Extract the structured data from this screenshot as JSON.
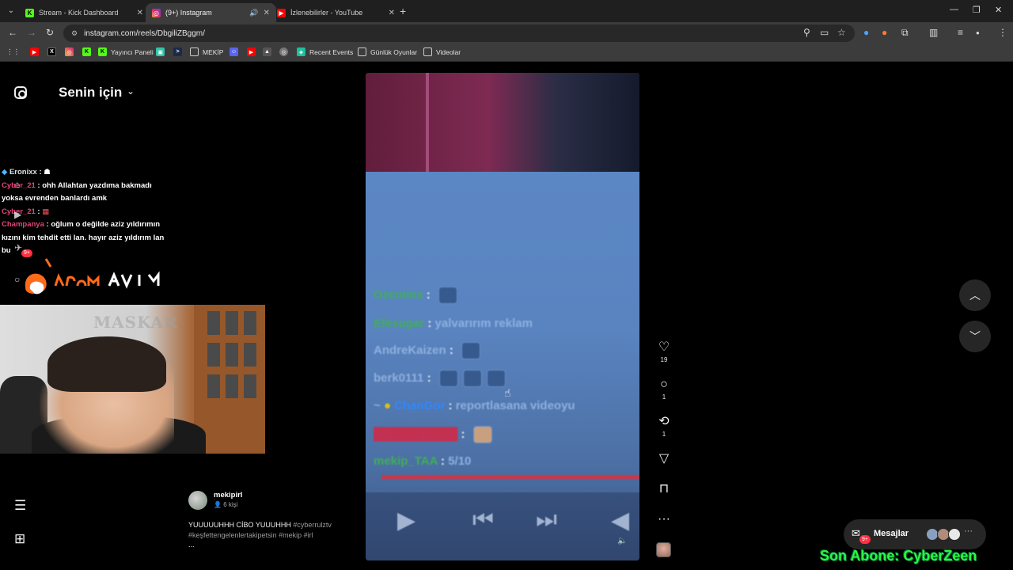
{
  "browser": {
    "tabs": [
      {
        "title": "Stream - Kick Dashboard",
        "favicon": "kick-icon",
        "color": "#53fc18"
      },
      {
        "title": "(9+) Instagram",
        "favicon": "instagram-icon",
        "color": "#d6287a"
      },
      {
        "title": "İzlenebilirler - YouTube",
        "favicon": "youtube-icon",
        "color": "#ff0000"
      }
    ],
    "url": "instagram.com/reels/DbgiliZBggm/",
    "bookmarks": [
      {
        "label": "",
        "icon": "youtube-icon"
      },
      {
        "label": "",
        "icon": "x-icon"
      },
      {
        "label": "",
        "icon": "instagram-icon"
      },
      {
        "label": "",
        "icon": "kick-icon"
      },
      {
        "label": "Yayıncı Paneli",
        "icon": "kick-icon"
      },
      {
        "label": "",
        "icon": "app-icon"
      },
      {
        "label": "",
        "icon": "terminal-icon"
      },
      {
        "label": "MEKİP",
        "icon": "folder-icon"
      },
      {
        "label": "",
        "icon": "discord-icon"
      },
      {
        "label": "",
        "icon": "youtube-icon"
      },
      {
        "label": "",
        "icon": "image-icon"
      },
      {
        "label": "",
        "icon": "circle-icon"
      },
      {
        "label": "Recent Events",
        "icon": "streamelements-icon"
      },
      {
        "label": "Günlük Oyunlar",
        "icon": "folder-icon"
      },
      {
        "label": "Videolar",
        "icon": "folder-icon"
      }
    ]
  },
  "instagram": {
    "feed_title": "Senin için",
    "notification_badge": "9+",
    "post": {
      "username": "mekipirl",
      "people": "6 kişi",
      "caption_text": "YUUUUUHHH CİBO YUUUHHH",
      "caption_tags": "#cyberrulztv #keşfettengelenlertakipetsin #mekip #irl",
      "caption_more": "..."
    },
    "actions": {
      "likes": "19",
      "comments": "1",
      "reposts": "1"
    },
    "messages_label": "Mesajlar",
    "messages_badge": "9+"
  },
  "stream_overlay": {
    "chat": [
      {
        "user": "Eronixx",
        "text": ""
      },
      {
        "user": "Cyber_21",
        "text": "ohh Allahtan yazdıma bakmadı yoksa evrenden banlardı amk"
      },
      {
        "user": "Cyber_21",
        "text": ""
      },
      {
        "user": "Champanya",
        "text": "oğlum o değilde aziz yıldırımın kızını kim tehdit etti lan. hayır aziz yıldırım lan bu"
      }
    ],
    "webcam_watermark": "MASKAR",
    "sub_alert": "Son Abone: CyberZeen"
  },
  "reel_video_chat": [
    {
      "user": "Ozenims",
      "text": "",
      "color": "#3fae56",
      "emotes": 1
    },
    {
      "user": "Efesugar",
      "text": "yalvarırım reklam",
      "color": "#3fae56",
      "emotes": 0
    },
    {
      "user": "AndreKaizen",
      "text": "",
      "color": "#8fb0e0",
      "emotes": 1
    },
    {
      "user": "berk0111",
      "text": "",
      "color": "#8fb0e0",
      "emotes": 3
    },
    {
      "user": "ChanGor",
      "text": "reportlasana videoyu",
      "color": "#2f88ff",
      "emotes": 0
    },
    {
      "user": "mekip_TAA",
      "text": "5/10",
      "color": "#3fae56",
      "emotes": 0
    }
  ]
}
